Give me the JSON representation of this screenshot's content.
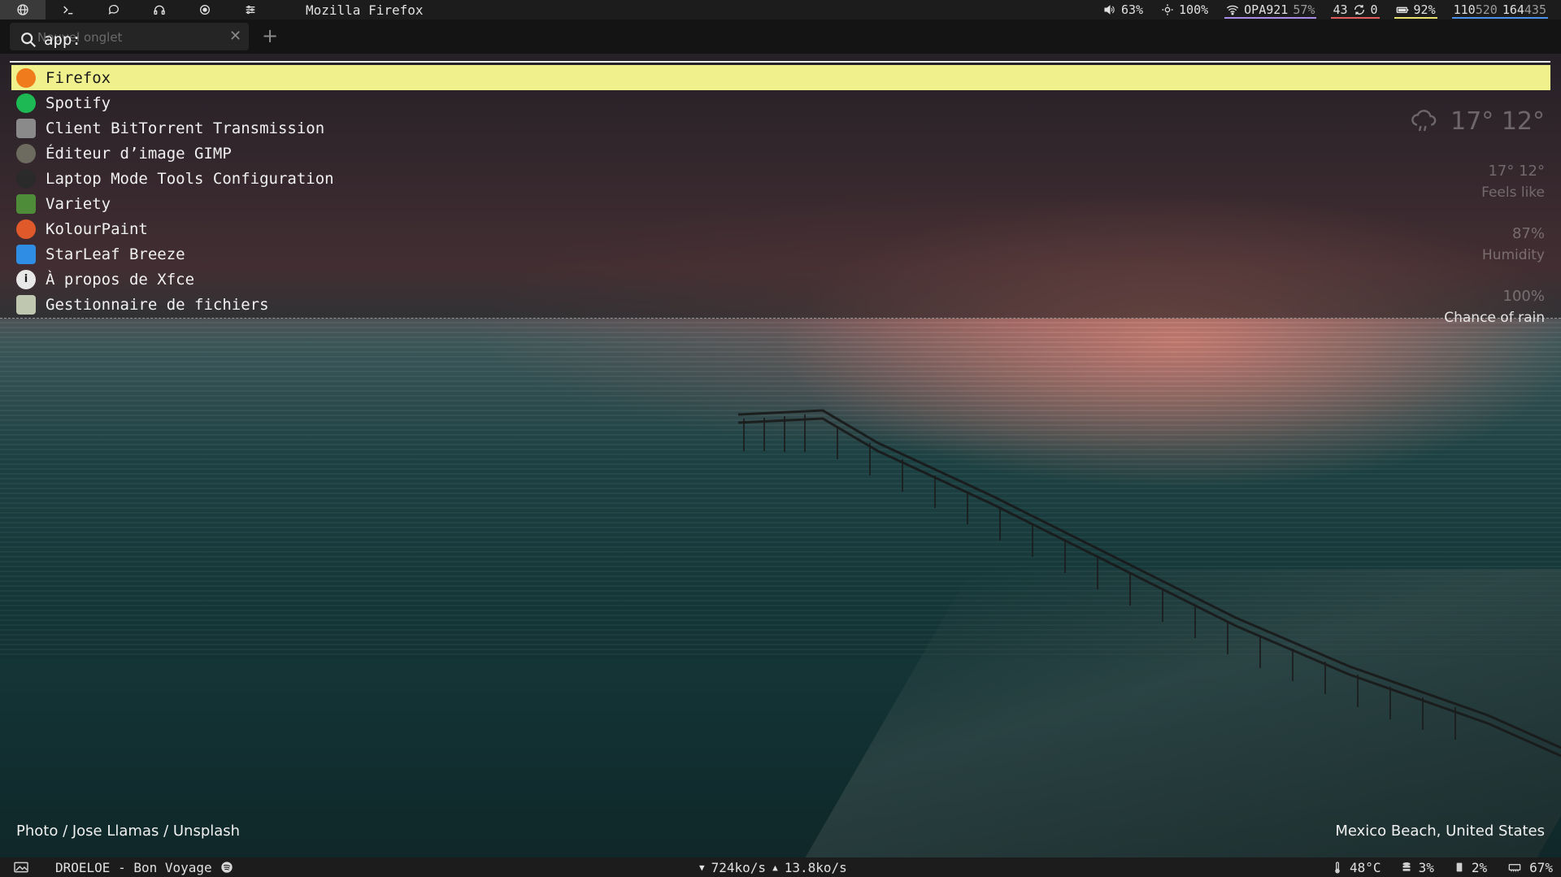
{
  "window_title": "Mozilla Firefox",
  "workspaces": [
    {
      "icon": "globe-icon",
      "active": true
    },
    {
      "icon": "terminal-icon",
      "active": false
    },
    {
      "icon": "chat-icon",
      "active": false
    },
    {
      "icon": "headphones-icon",
      "active": false
    },
    {
      "icon": "target-icon",
      "active": false
    },
    {
      "icon": "sliders-icon",
      "active": false
    }
  ],
  "tray": {
    "volume": "63%",
    "brightness": "100%",
    "wifi_ssid": "OPA921",
    "wifi_signal": "57%",
    "updates_count": "43",
    "sync_count": "0",
    "battery": "92%",
    "traffic_a_main": "110",
    "traffic_a_dim": "520",
    "traffic_b_main": "164",
    "traffic_b_dim": "435",
    "colors": {
      "wifi": "#a98be8",
      "updates": "#e35b5b",
      "battery": "#e8e26b",
      "traffic": "#4a8fe8"
    }
  },
  "firefox": {
    "tab_title": "Nouvel onglet",
    "close_symbol": "✕",
    "new_tab_symbol": "+"
  },
  "launcher": {
    "query": "app:",
    "items": [
      {
        "label": "Firefox",
        "icon": "firefox-icon",
        "color": "#f07b1c",
        "selected": true
      },
      {
        "label": "Spotify",
        "icon": "spotify-icon",
        "color": "#1db954",
        "selected": false
      },
      {
        "label": "Client BitTorrent Transmission",
        "icon": "transmission-icon",
        "color": "#8a8a8a",
        "selected": false
      },
      {
        "label": "Éditeur d’image GIMP",
        "icon": "gimp-icon",
        "color": "#6d6a5f",
        "selected": false
      },
      {
        "label": "Laptop Mode Tools Configuration",
        "icon": "laptop-mode-icon",
        "color": "#2a2a2a",
        "selected": false
      },
      {
        "label": "Variety",
        "icon": "variety-icon",
        "color": "#4f8c3a",
        "selected": false
      },
      {
        "label": "KolourPaint",
        "icon": "kolourpaint-icon",
        "color": "#e0592a",
        "selected": false
      },
      {
        "label": "StarLeaf Breeze",
        "icon": "starleaf-icon",
        "color": "#2f8de4",
        "selected": false
      },
      {
        "label": "À propos de Xfce",
        "icon": "info-icon",
        "color": "#e8e8e8",
        "selected": false
      },
      {
        "label": "Gestionnaire de fichiers",
        "icon": "file-manager-icon",
        "color": "#bfc7b0",
        "selected": false
      }
    ]
  },
  "weather": {
    "temps": "17° 12°",
    "feels_like_value": "17° 12°",
    "feels_like_label": "Feels like",
    "humidity_value": "87%",
    "humidity_label": "Humidity",
    "rain_value": "100%",
    "rain_label": "Chance of rain"
  },
  "photo_credit": "Photo / Jose Llamas / Unsplash",
  "location": "Mexico Beach, United States",
  "bottombar": {
    "now_playing": "DROELOE - Bon Voyage",
    "download_speed": "724ko/s",
    "upload_speed": "13.8ko/s",
    "temperature": "48°C",
    "disk": "3%",
    "cpu": "2%",
    "memory": "67%"
  }
}
